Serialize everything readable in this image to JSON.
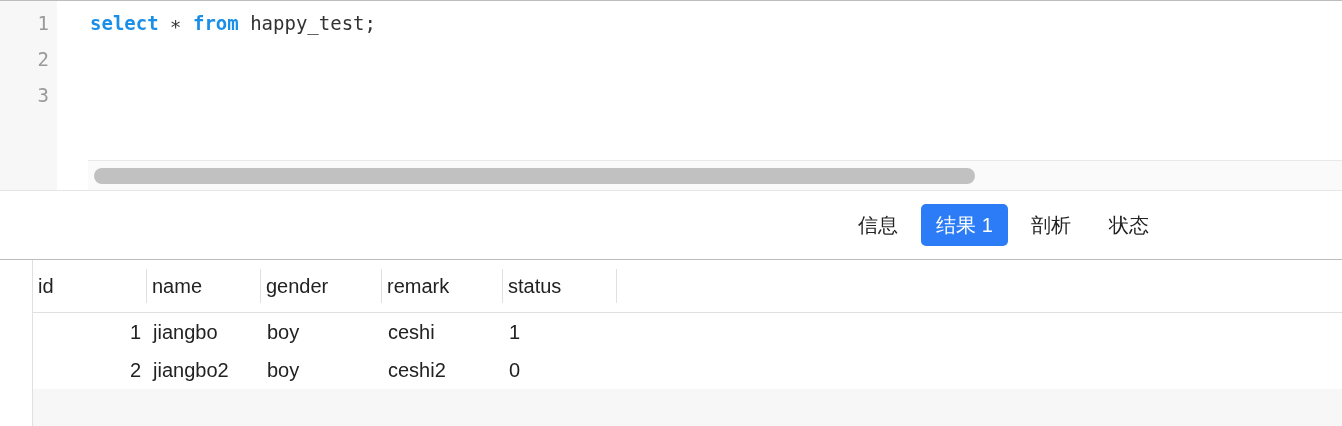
{
  "editor": {
    "lines": [
      {
        "number": "1",
        "tokens": [
          {
            "kind": "keyword",
            "text": "select"
          },
          {
            "kind": "plain",
            "text": " ∗ "
          },
          {
            "kind": "keyword",
            "text": "from"
          },
          {
            "kind": "plain",
            "text": " happy_test;"
          }
        ]
      },
      {
        "number": "2"
      },
      {
        "number": "3"
      }
    ]
  },
  "tabs": [
    {
      "label": "信息",
      "selected": false
    },
    {
      "label": "结果 1",
      "selected": true
    },
    {
      "label": "剖析",
      "selected": false
    },
    {
      "label": "状态",
      "selected": false
    }
  ],
  "table": {
    "columns": [
      "id",
      "name",
      "gender",
      "remark",
      "status"
    ],
    "rows": [
      [
        "1",
        "jiangbo",
        "boy",
        "ceshi",
        "1"
      ],
      [
        "2",
        "jiangbo2",
        "boy",
        "ceshi2",
        "0"
      ]
    ]
  }
}
